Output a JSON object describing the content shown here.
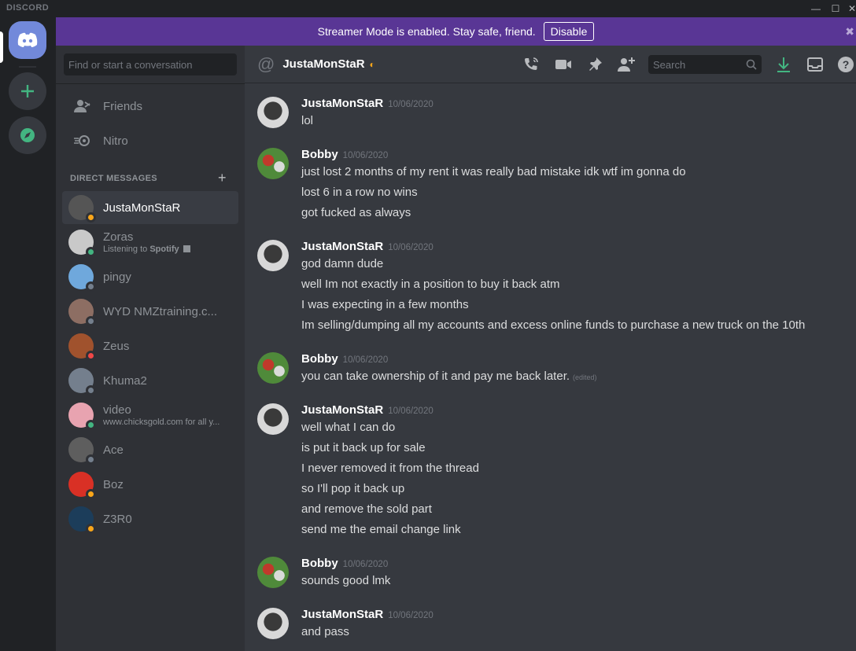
{
  "app": {
    "wordmark": "DISCORD",
    "min": "—",
    "max": "☐",
    "close": "✕"
  },
  "banner": {
    "text": "Streamer Mode is enabled. Stay safe, friend.",
    "button": "Disable",
    "close": "✖"
  },
  "dm_panel": {
    "search_placeholder": "Find or start a conversation",
    "nav": [
      {
        "label": "Friends",
        "icon": "friends-icon"
      },
      {
        "label": "Nitro",
        "icon": "nitro-icon"
      }
    ],
    "section_label": "DIRECT MESSAGES",
    "add": "+",
    "items": [
      {
        "name": "JustaMonStaR",
        "status": "idle",
        "active": true,
        "avatar_color": "#555555"
      },
      {
        "name": "Zoras",
        "sub_prefix": "Listening to ",
        "sub_bold": "Spotify",
        "status": "online",
        "avatar_color": "#c9c9c9"
      },
      {
        "name": "pingy",
        "status": "offline",
        "avatar_color": "#6fa8dc"
      },
      {
        "name": "WYD NMZtraining.c...",
        "status": "offline",
        "avatar_color": "#8d6e63"
      },
      {
        "name": "Zeus",
        "status": "dnd",
        "avatar_color": "#a0522d"
      },
      {
        "name": "Khuma2",
        "status": "offline",
        "avatar_color": "#747f8d"
      },
      {
        "name": "video",
        "sub": "www.chicksgold.com for all y...",
        "status": "online",
        "avatar_color": "#e8a3b0"
      },
      {
        "name": "Ace",
        "status": "offline",
        "avatar_color": "#5e5e5e"
      },
      {
        "name": "Boz",
        "status": "idle",
        "avatar_color": "#d93025"
      },
      {
        "name": "Z3R0",
        "status": "idle",
        "avatar_color": "#1c3d5a"
      }
    ]
  },
  "chat": {
    "at": "@",
    "title": "JustaMonStaR",
    "moon": "◐",
    "search_placeholder": "Search",
    "messages": [
      {
        "author": "JustaMonStaR",
        "timestamp": "10/06/2020",
        "lines": [
          "lol"
        ]
      },
      {
        "author": "Bobby",
        "timestamp": "10/06/2020",
        "lines": [
          "just lost 2 months of my rent it was really bad mistake idk wtf im gonna do",
          "lost 6 in a row no wins",
          "got fucked as always"
        ]
      },
      {
        "author": "JustaMonStaR",
        "timestamp": "10/06/2020",
        "lines": [
          "god damn dude",
          "well Im not exactly in a position to buy it back atm",
          "I was expecting in a few months",
          "Im selling/dumping all my accounts and excess online funds to purchase a new truck on the 10th"
        ]
      },
      {
        "author": "Bobby",
        "timestamp": "10/06/2020",
        "lines": [
          "you can take ownership of it and pay me back later."
        ],
        "edited": "(edited)"
      },
      {
        "author": "JustaMonStaR",
        "timestamp": "10/06/2020",
        "lines": [
          "well what I can do",
          "is put it back up for sale",
          "I never removed it from the thread",
          "so I'll pop it back up",
          "and remove the sold part",
          "send me the email change link"
        ]
      },
      {
        "author": "Bobby",
        "timestamp": "10/06/2020",
        "lines": [
          "sounds good lmk"
        ]
      },
      {
        "author": "JustaMonStaR",
        "timestamp": "10/06/2020",
        "lines": [
          "and pass"
        ]
      }
    ]
  },
  "colors": {
    "online": "#43b581",
    "idle": "#faa61a",
    "dnd": "#f04747",
    "offline": "#747f8d",
    "blurple": "#7289da",
    "streamer": "#593695"
  }
}
